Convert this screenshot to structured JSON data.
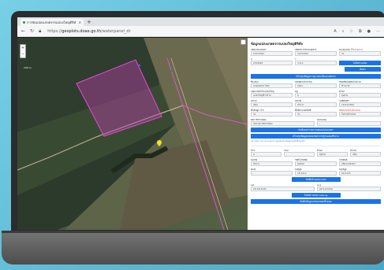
{
  "browser": {
    "tab_title": "การจัดแปลงเกษตรกรแปลงใหญ่ดิจิทัล",
    "url_domain": "geoplots.doae.go.th",
    "url_path": "/waterpanel_dr",
    "url_prefix": "https://"
  },
  "map": {
    "zoom_in": "+",
    "zoom_out": "−",
    "scale_text": "100 m"
  },
  "panel": {
    "title": "ข้อมูลแปลงเกษตรกรแปลงใหญ่ดิจิทัล",
    "row1": [
      {
        "label": "รหัสแปลงเกษตร",
        "value": "14154461"
      },
      {
        "label": "รหัสประจำตัวเกษตรกร",
        "value": "14154461"
      },
      {
        "label": "ขนาดแปลง (ไร่-งาน-วา)",
        "value": "31"
      }
    ],
    "row2": [
      {
        "label": "X",
        "value": "1519963"
      },
      {
        "label": "Y",
        "value": "3-0-0"
      }
    ],
    "btn_locate": "ไปยังตำแหน่ง",
    "btn_search": "ค้นหา",
    "btn_update_info": "ปรับปรุงข้อมูลจากฐานทะเบียนเกษตรกร",
    "row3": [
      {
        "label": "ชื่อ-สกุล",
        "value": "นายสมชาย ไชยา"
      },
      {
        "label": "เลขบัตรประชาชน",
        "value": "3001"
      },
      {
        "label": "ชนิดพืช/ปศุสัตว์/ประมง",
        "value": "ข้าวนาปี"
      }
    ],
    "row4": [
      {
        "label": "กลุ่มเกษตรกร/แปลงใหญ่",
        "value": "แปลงใหญ่ข้าวบ้าน"
      },
      {
        "label": "หมู่",
        "value": "9"
      },
      {
        "label": "ตำบล",
        "value": "ทุ่งฝาย"
      }
    ],
    "row5": [
      {
        "label": "อำเภอ",
        "value": "เมือง"
      },
      {
        "label": "จังหวัด",
        "value": "ลำปาง"
      },
      {
        "label": "วันที่บันทึก",
        "value": "15/04/2565"
      }
    ],
    "row6": [
      {
        "label": "พื้นที่ปลูก (ไร่)",
        "value": "31"
      },
      {
        "label": "พื้นที่ตามเอกสิทธิ์",
        "value": "31"
      },
      {
        "label": "พิกัดแปลงตรงตำแหน่ง",
        "value": "ไม่ตรงตำแหน่ง"
      }
    ],
    "row7": [
      {
        "label": "ผลการตรวจสอบ",
        "value": "ไม่ผ่านการตรวจสอบ"
      },
      {
        "label": "หมายเหตุ",
        "value": "-"
      }
    ],
    "btn_save_check": "บันทึกผลการตรวจสอบแปลงเกษตร",
    "btn_update_plot": "ปรับปรุงข้อมูลแปลงเกษตรจากฐานแผนที่กลาง",
    "note": "หมายเหตุ: กรุณาตรวจสอบความถูกต้องของข้อมูลก่อนบันทึกทุกครั้ง",
    "row8": [
      {
        "label": "บ้าน",
        "value": "9"
      },
      {
        "label": "ถนน",
        "value": "-"
      },
      {
        "label": "ตำบล",
        "value": "ทุ่งฝาย"
      },
      {
        "label": "อำเภอ",
        "value": "เมือง"
      }
    ],
    "row9": [
      {
        "label": "จังหวัด",
        "value": "ลำปาง"
      },
      {
        "label": "รหัสไปรษณีย์",
        "value": "52000"
      },
      {
        "label": "โทรศัพท์",
        "value": "0891234567"
      }
    ],
    "row10": [
      {
        "label": "อีเมล",
        "value": "-"
      },
      {
        "label": "ละติจูด",
        "value": "18.3412"
      },
      {
        "label": "ลองจิจูด",
        "value": "99.5123"
      }
    ],
    "btn_save_gps": "บันทึกตำแหน่ง GPS",
    "row11": [
      {
        "label": "Lat",
        "value": "18.3412345"
      },
      {
        "label": "Lng",
        "value": "99.5123456"
      }
    ],
    "btn_locate2": "ไปยังตำแหน่ง Lat/Lng",
    "btn_save_all": "บันทึกข้อมูลแปลงเกษตรทั้งหมด"
  },
  "colors": {
    "accent": "#1a73e8",
    "plot_outline": "#e24bd2",
    "marker": "#f2e21f"
  }
}
